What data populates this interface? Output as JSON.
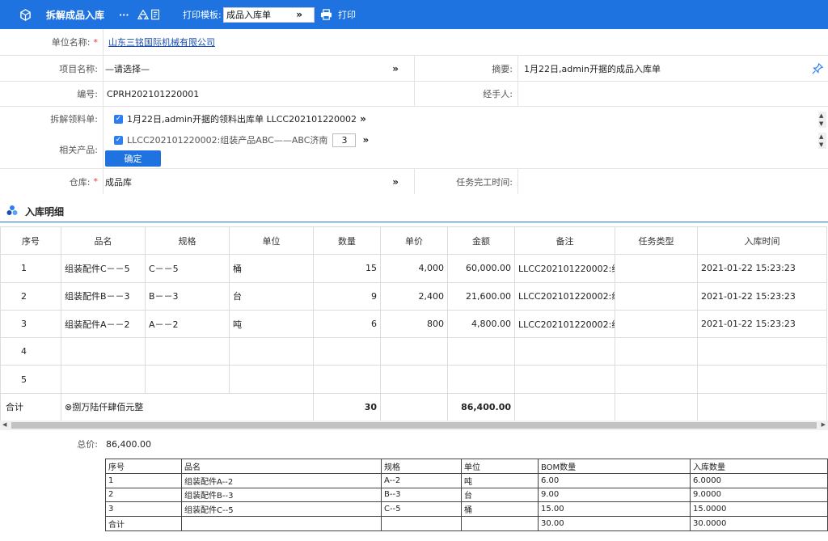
{
  "toolbar": {
    "title": "拆解成品入库",
    "more": "···",
    "print_template_label": "打印模板:",
    "print_template_value": "成品入库单",
    "print_label": "打印"
  },
  "form": {
    "company": {
      "label": "单位名称:",
      "value": "山东三铭国际机械有限公司"
    },
    "project": {
      "label": "项目名称:",
      "value": "—请选择—"
    },
    "summary": {
      "label": "摘要:",
      "value": "1月22日,admin开据的成品入库单"
    },
    "number": {
      "label": "编号:",
      "value": "CPRH202101220001"
    },
    "handler": {
      "label": "经手人:",
      "value": ""
    },
    "split_material": {
      "label": "拆解领料单:",
      "value": "1月22日,admin开据的领料出库单 LLCC202101220002"
    },
    "related_product": {
      "label": "相关产品:",
      "value": "LLCC202101220002:组装产品ABC——ABC济南",
      "qty": "3",
      "confirm": "确定"
    },
    "warehouse": {
      "label": "仓库:",
      "value": "成品库"
    },
    "task_done_time": {
      "label": "任务完工时间:",
      "value": ""
    }
  },
  "section": {
    "title": "入库明细"
  },
  "grid": {
    "headers": [
      "序号",
      "品名",
      "规格",
      "单位",
      "数量",
      "单价",
      "金额",
      "备注",
      "任务类型",
      "入库时间"
    ],
    "rows": [
      [
        "1",
        "组装配件C－－5",
        "C－－5",
        "桶",
        "15",
        "4,000",
        "60,000.00",
        "LLCC202101220002:组",
        "",
        "2021-01-22 15:23:23"
      ],
      [
        "2",
        "组装配件B－－3",
        "B－－3",
        "台",
        "9",
        "2,400",
        "21,600.00",
        "LLCC202101220002:组",
        "",
        "2021-01-22 15:23:23"
      ],
      [
        "3",
        "组装配件A－－2",
        "A－－2",
        "吨",
        "6",
        "800",
        "4,800.00",
        "LLCC202101220002:组",
        "",
        "2021-01-22 15:23:23"
      ],
      [
        "4",
        "",
        "",
        "",
        "",
        "",
        "",
        "",
        "",
        ""
      ],
      [
        "5",
        "",
        "",
        "",
        "",
        "",
        "",
        "",
        "",
        ""
      ]
    ],
    "total": {
      "label": "合计",
      "amount_words": "⊗捌万陆仟肆佰元整",
      "qty": "30",
      "amount": "86,400.00"
    }
  },
  "total_price": {
    "label": "总价:",
    "value": "86,400.00"
  },
  "bom": {
    "headers": [
      "序号",
      "品名",
      "规格",
      "单位",
      "BOM数量",
      "入库数量"
    ],
    "rows": [
      [
        "1",
        "组装配件A--2",
        "A--2",
        "吨",
        "6.00",
        "6.0000"
      ],
      [
        "2",
        "组装配件B--3",
        "B--3",
        "台",
        "9.00",
        "9.0000"
      ],
      [
        "3",
        "组装配件C--5",
        "C--5",
        "桶",
        "15.00",
        "15.0000"
      ]
    ],
    "total": [
      "合计",
      "",
      "",
      "",
      "30.00",
      "30.0000"
    ]
  },
  "icons": {
    "app": "cube-icon",
    "recycle": "recycle-icon",
    "doc": "document-icon",
    "print": "printer-icon",
    "pin": "pin-icon",
    "section": "dots-cluster-icon"
  },
  "colors": {
    "primary": "#1e73e0",
    "required": "#e53935",
    "link": "#1a4fb5"
  }
}
